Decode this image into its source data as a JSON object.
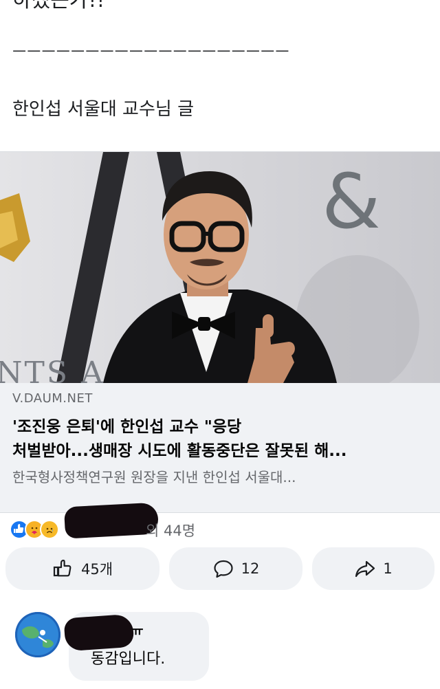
{
  "post": {
    "cut_line": "하겠는가!!",
    "divider": "ㅡㅡㅡㅡㅡㅡㅡㅡㅡㅡㅡㅡㅡㅡㅡㅡㅡㅡㅡ",
    "body_line": "한인섭 서울대 교수님 글"
  },
  "link_card": {
    "domain": "V.DAUM.NET",
    "headline_line1": "'조진웅 은퇴'에 한인섭 교수 \"응당",
    "headline_line2": "처벌받아...생매장 시도에 활동중단은 잘못된 해...",
    "description": "한국형사정책연구원 원장을 지낸 한인섭 서울대...",
    "photo_text_symbol": "&",
    "photo_text_banner": "NTS A"
  },
  "reactions": {
    "icons": [
      "like-icon",
      "care-icon",
      "sad-icon"
    ],
    "count_text": "외 44명"
  },
  "actions": {
    "like_count": "45개",
    "comment_count": "12",
    "share_count": "1"
  },
  "comment": {
    "name_tail": "ㅠ",
    "text": "동감입니다."
  },
  "colors": {
    "accent": "#1877f2",
    "card_bg": "#f0f2f5",
    "muted_text": "#65676b"
  }
}
